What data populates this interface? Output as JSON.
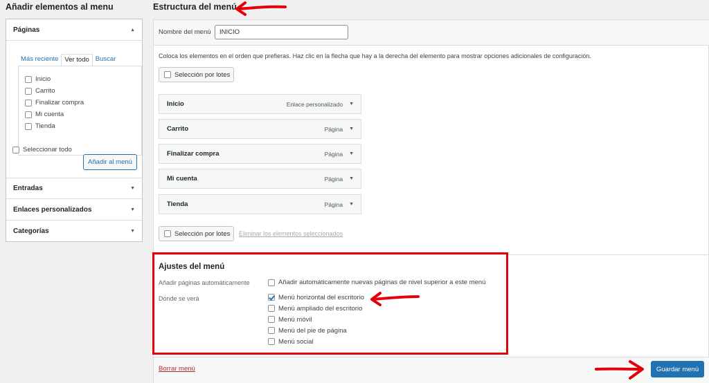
{
  "left": {
    "title": "Añadir elementos al menu",
    "pages_section": "Páginas",
    "tabs": [
      "Más reciente",
      "Ver todo",
      "Buscar"
    ],
    "pages": [
      "Inicio",
      "Carrito",
      "Finalizar compra",
      "Mi cuenta",
      "Tienda"
    ],
    "select_all": "Seleccionar todo",
    "add_button": "Añadir al menú",
    "sections": [
      "Entradas",
      "Enlaces personalizados",
      "Categorías"
    ]
  },
  "main": {
    "title": "Estructura del menú",
    "name_label": "Nombre del menú",
    "name_value": "INICIO",
    "instructions": "Coloca los elementos en el orden que prefieras. Haz clic en la flecha que hay a la derecha del elemento para mostrar opciones adicionales de configuración.",
    "bulk_select": "Selección por lotes",
    "remove_selected": "Eliminar los elementos seleccionados",
    "items": [
      {
        "title": "Inicio",
        "type": "Enlace personalizado"
      },
      {
        "title": "Carrito",
        "type": "Página"
      },
      {
        "title": "Finalizar compra",
        "type": "Página"
      },
      {
        "title": "Mi cuenta",
        "type": "Página"
      },
      {
        "title": "Tienda",
        "type": "Página"
      }
    ]
  },
  "settings": {
    "title": "Ajustes del menú",
    "auto_add_label": "Añadir páginas automáticamente",
    "auto_add_option": "Añadir automáticamente nuevas páginas de nivel superior a este menú",
    "location_label": "Dónde se verá",
    "locations": [
      {
        "label": "Menú horizontal del escritorio",
        "checked": true
      },
      {
        "label": "Menú ampliado del escritorio",
        "checked": false
      },
      {
        "label": "Menú móvil",
        "checked": false
      },
      {
        "label": "Menú del pie de página",
        "checked": false
      },
      {
        "label": "Menú social",
        "checked": false
      }
    ]
  },
  "footer": {
    "delete_menu": "Borrar menú",
    "save_menu": "Guardar menú"
  },
  "colors": {
    "accent": "#2271b1",
    "annotation": "#e3000b",
    "danger": "#b32d2e"
  }
}
